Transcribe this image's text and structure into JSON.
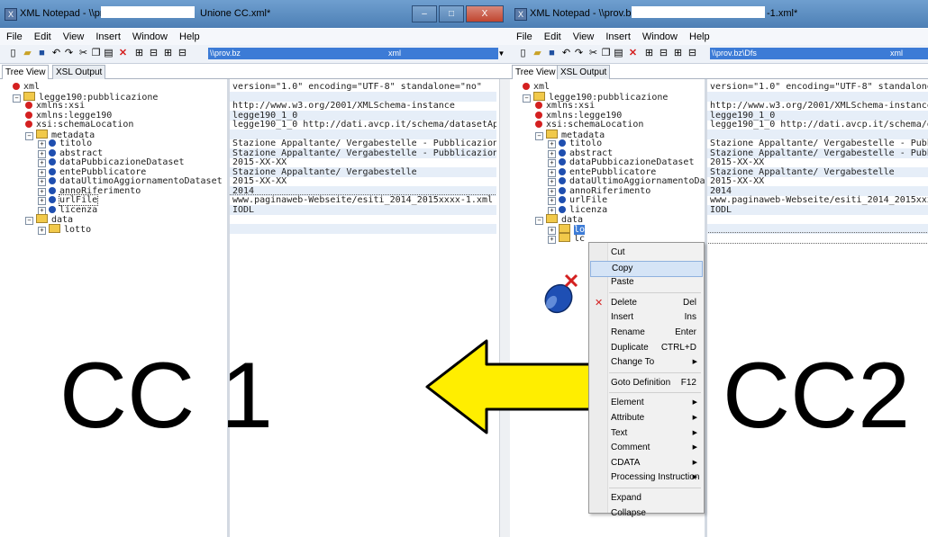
{
  "left_window": {
    "title_prefix": "XML Notepad - \\\\prov",
    "title_suffix": "Unione CC.xml*",
    "address_start": "\\\\prov.bz",
    "address_end": "xml"
  },
  "right_window": {
    "title_prefix": "XML Notepad - \\\\prov.bz\\Df",
    "title_suffix": "-1.xml*",
    "address_start": "\\\\prov.bz\\Dfs",
    "address_end": "xml"
  },
  "menu": [
    "File",
    "Edit",
    "View",
    "Insert",
    "Window",
    "Help"
  ],
  "tabs": [
    "Tree View",
    "XSL Output"
  ],
  "caption_buttons": {
    "minimize": "–",
    "maximize": "□",
    "close": "X"
  },
  "tree": [
    {
      "label": "xml",
      "icon": "red"
    },
    {
      "label": "legge190:pubblicazione",
      "icon": "folder"
    },
    {
      "label": "xmlns:xsi",
      "icon": "red"
    },
    {
      "label": "xmlns:legge190",
      "icon": "red"
    },
    {
      "label": "xsi:schemaLocation",
      "icon": "red"
    },
    {
      "label": "metadata",
      "icon": "folder"
    },
    {
      "label": "titolo",
      "icon": "blue"
    },
    {
      "label": "abstract",
      "icon": "blue"
    },
    {
      "label": "dataPubbicazioneDataset",
      "icon": "blue"
    },
    {
      "label": "entePubblicatore",
      "icon": "blue"
    },
    {
      "label": "dataUltimoAggiornamentoDataset",
      "icon": "blue"
    },
    {
      "label": "annoRiferimento",
      "icon": "blue"
    },
    {
      "label": "urlFile",
      "icon": "blue"
    },
    {
      "label": "licenza",
      "icon": "blue"
    },
    {
      "label": "data",
      "icon": "folder"
    },
    {
      "label": "lotto",
      "icon": "folder"
    }
  ],
  "values_left": [
    "version=\"1.0\" encoding=\"UTF-8\" standalone=\"no\"",
    "",
    "http://www.w3.org/2001/XMLSchema-instance",
    "legge190_1_0",
    "legge190_1_0 http://dati.avcp.it/schema/datasetAppalti…",
    "",
    "Stazione Appaltante/ Vergabestelle - Pubblicazione…",
    "Stazione Appaltante/ Vergabestelle - Pubblicazione…",
    "2015-XX-XX",
    "Stazione Appaltante/ Vergabestelle",
    "2015-XX-XX",
    "2014",
    "www.paginaweb-Webseite/esiti_2014_2015xxxx-1.xml",
    "IODL",
    "",
    ""
  ],
  "values_right": [
    "version=\"1.0\" encoding=\"UTF-8\" standalone=\"no\"",
    "",
    "http://www.w3.org/2001/XMLSchema-instance",
    "legge190_1_0",
    "legge190_1_0 http://dati.avcp.it/schema/datase",
    "",
    "Stazione Appaltante/ Vergabestelle - Pubblicaz",
    "Stazione Appaltante/ Vergabestelle - Pubblicaz",
    "2015-XX-XX",
    "Stazione Appaltante/ Vergabestelle",
    "2015-XX-XX",
    "2014",
    "www.paginaweb-Webseite/esiti_2014_2015xxxx-1.x",
    "IODL",
    "",
    ""
  ],
  "right_tree_extra": {
    "selected_fragment": "lo",
    "second_fragment": "lc"
  },
  "overlay": {
    "left_label": "CC 1",
    "right_label": "CC2",
    "arrow_color": "#ffee00"
  },
  "context_menu": [
    {
      "label": "Cut",
      "shortcut": ""
    },
    {
      "label": "Copy",
      "shortcut": "",
      "highlighted": true
    },
    {
      "label": "Paste",
      "shortcut": ""
    },
    {
      "sep": true
    },
    {
      "label": "Delete",
      "shortcut": "Del",
      "icon": "delete-x"
    },
    {
      "label": "Insert",
      "shortcut": "Ins"
    },
    {
      "label": "Rename",
      "shortcut": "Enter"
    },
    {
      "label": "Duplicate",
      "shortcut": "CTRL+D"
    },
    {
      "label": "Change To",
      "submenu": true
    },
    {
      "sep": true
    },
    {
      "label": "Goto Definition",
      "shortcut": "F12"
    },
    {
      "sep": true
    },
    {
      "label": "Element",
      "submenu": true
    },
    {
      "label": "Attribute",
      "submenu": true
    },
    {
      "label": "Text",
      "submenu": true
    },
    {
      "label": "Comment",
      "submenu": true
    },
    {
      "label": "CDATA",
      "submenu": true
    },
    {
      "label": "Processing Instruction",
      "submenu": true
    },
    {
      "sep": true
    },
    {
      "label": "Expand"
    },
    {
      "label": "Collapse"
    }
  ]
}
